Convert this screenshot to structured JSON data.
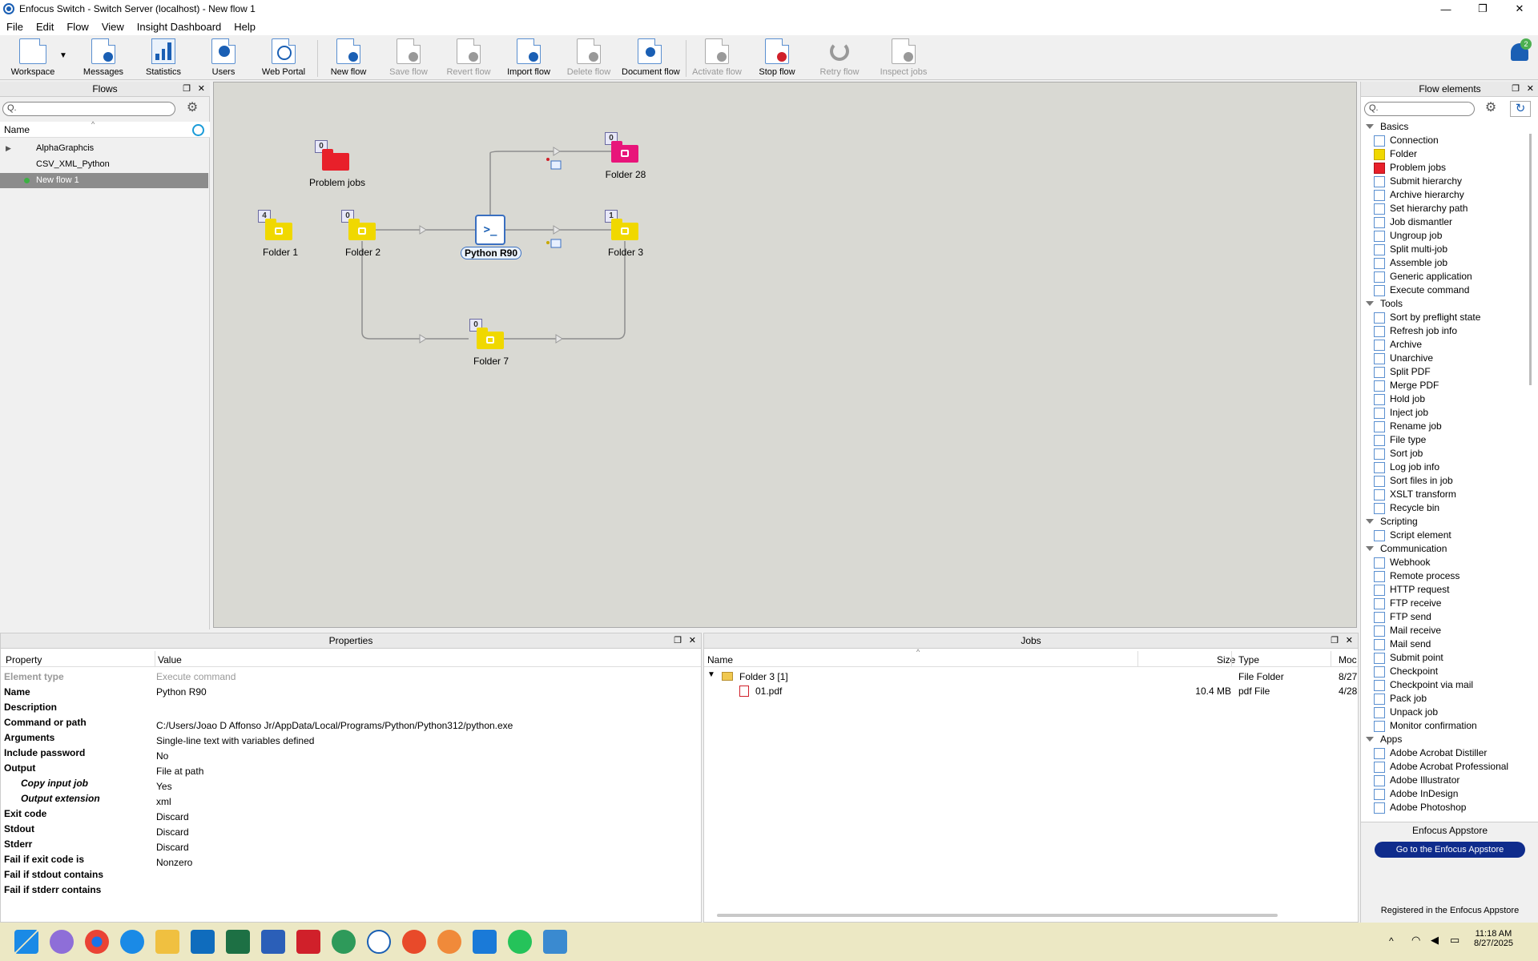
{
  "window": {
    "title": "Enfocus Switch - Switch Server (localhost) - New flow 1",
    "minimize": "—",
    "maximize": "❐",
    "close": "✕"
  },
  "menu": [
    "File",
    "Edit",
    "Flow",
    "View",
    "Insight Dashboard",
    "Help"
  ],
  "toolbar": {
    "workspace": "Workspace",
    "messages": "Messages",
    "statistics": "Statistics",
    "users": "Users",
    "web_portal": "Web Portal",
    "new_flow": "New flow",
    "save_flow": "Save flow",
    "revert_flow": "Revert flow",
    "import_flow": "Import flow",
    "delete_flow": "Delete flow",
    "document_flow": "Document flow",
    "activate_flow": "Activate flow",
    "stop_flow": "Stop flow",
    "retry_flow": "Retry flow",
    "inspect_jobs": "Inspect jobs",
    "notification_count": "2"
  },
  "flows_panel": {
    "title": "Flows",
    "column": "Name",
    "items": [
      "AlphaGraphcis",
      "CSV_XML_Python",
      "New flow 1"
    ]
  },
  "canvas": {
    "nodes": {
      "problem_jobs": {
        "label": "Problem jobs",
        "count": "0"
      },
      "folder1": {
        "label": "Folder 1",
        "count": "4"
      },
      "folder2": {
        "label": "Folder 2",
        "count": "0"
      },
      "python": {
        "label": "Python R90",
        "glyph": ">_"
      },
      "folder3": {
        "label": "Folder 3",
        "count": "1"
      },
      "folder28": {
        "label": "Folder 28",
        "count": "0"
      },
      "folder7": {
        "label": "Folder 7",
        "count": "0"
      }
    }
  },
  "properties": {
    "title": "Properties",
    "col_property": "Property",
    "col_value": "Value",
    "rows": [
      {
        "k": "Element type",
        "v": "Execute command"
      },
      {
        "k": "Name",
        "v": "Python R90"
      },
      {
        "k": "Description",
        "v": ""
      },
      {
        "k": "Command or path",
        "v": "C:/Users/Joao D Affonso Jr/AppData/Local/Programs/Python/Python312/python.exe"
      },
      {
        "k": "Arguments",
        "v": "Single-line text with variables defined"
      },
      {
        "k": "Include password",
        "v": "No"
      },
      {
        "k": "Output",
        "v": "File at path"
      },
      {
        "k": "Copy input job",
        "v": "Yes"
      },
      {
        "k": "Output extension",
        "v": "xml"
      },
      {
        "k": "Exit code",
        "v": "Discard"
      },
      {
        "k": "Stdout",
        "v": "Discard"
      },
      {
        "k": "Stderr",
        "v": "Discard"
      },
      {
        "k": "Fail if exit code is",
        "v": "Nonzero"
      },
      {
        "k": "Fail if stdout contains",
        "v": ""
      },
      {
        "k": "Fail if stderr contains",
        "v": ""
      }
    ]
  },
  "jobs": {
    "title": "Jobs",
    "cols": {
      "name": "Name",
      "size": "Size",
      "type": "Type",
      "mod": "Moc"
    },
    "rows": [
      {
        "name": "Folder 3 [1]",
        "size": "",
        "type": "File Folder",
        "mod": "8/27"
      },
      {
        "name": "01.pdf",
        "size": "10.4 MB",
        "type": "pdf File",
        "mod": "4/28"
      }
    ]
  },
  "flow_elements": {
    "title": "Flow elements",
    "categories": [
      {
        "name": "Basics",
        "items": [
          "Connection",
          "Folder",
          "Problem jobs",
          "Submit hierarchy",
          "Archive hierarchy",
          "Set hierarchy path",
          "Job dismantler",
          "Ungroup job",
          "Split multi-job",
          "Assemble job",
          "Generic application",
          "Execute command"
        ]
      },
      {
        "name": "Tools",
        "items": [
          "Sort by preflight state",
          "Refresh job info",
          "Archive",
          "Unarchive",
          "Split PDF",
          "Merge PDF",
          "Hold job",
          "Inject job",
          "Rename job",
          "File type",
          "Sort job",
          "Log job info",
          "Sort files in job",
          "XSLT transform",
          "Recycle bin"
        ]
      },
      {
        "name": "Scripting",
        "items": [
          "Script element"
        ]
      },
      {
        "name": "Communication",
        "items": [
          "Webhook",
          "Remote process",
          "HTTP request",
          "FTP receive",
          "FTP send",
          "Mail receive",
          "Mail send",
          "Submit point",
          "Checkpoint",
          "Checkpoint via mail",
          "Pack job",
          "Unpack job",
          "Monitor confirmation"
        ]
      },
      {
        "name": "Apps",
        "items": [
          "Adobe Acrobat Distiller",
          "Adobe Acrobat Professional",
          "Adobe Illustrator",
          "Adobe InDesign",
          "Adobe Photoshop"
        ]
      }
    ],
    "appstore_title": "Enfocus Appstore",
    "appstore_button": "Go to the Enfocus Appstore",
    "registered": "Registered in the Enfocus Appstore"
  },
  "taskbar": {
    "time": "11:18 AM",
    "date": "8/27/2025"
  },
  "colors": {
    "accent": "#1a5fb4",
    "folder_yellow": "#f0d800",
    "problem_red": "#e8202a",
    "folder_pink": "#e8157a",
    "canvas": "#d9d9d3"
  }
}
